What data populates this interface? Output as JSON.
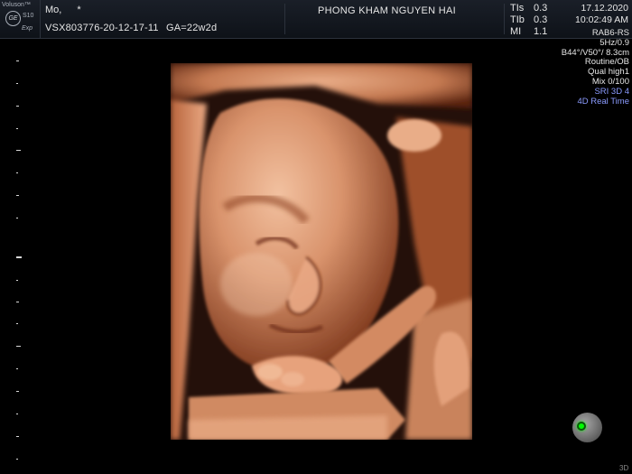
{
  "brand": {
    "name": "Voluson™",
    "logo_text": "GE",
    "model": "S10",
    "exp": "Exp"
  },
  "patient": {
    "name": "Mo,",
    "flag": "*",
    "id_line": "VSX803776-20-12-17-11",
    "ga": "GA=22w2d"
  },
  "clinic": "PHONG KHAM NGUYEN HAI",
  "indices": [
    {
      "label": "TIs",
      "value": "0.3"
    },
    {
      "label": "TIb",
      "value": "0.3"
    },
    {
      "label": "MI",
      "value": "1.1"
    }
  ],
  "date": "17.12.2020",
  "time": "10:02:49 AM",
  "params": [
    "RAB6-RS",
    "5Hz/0.9",
    "B44°/V50°/ 8.3cm",
    "Routine/OB",
    "Qual high1",
    "Mix 0/100"
  ],
  "params_accent": [
    "SRI 3D 4",
    "4D Real Time"
  ],
  "mode_badge": "3D",
  "icons": {
    "logo": "ge-logo-icon",
    "trackball": "trackball-icon"
  },
  "colors": {
    "background": "#000000",
    "header": "#141a22",
    "accent_text": "#8b9bff",
    "indicator": "#00ff00",
    "skin": "#c98a66"
  }
}
